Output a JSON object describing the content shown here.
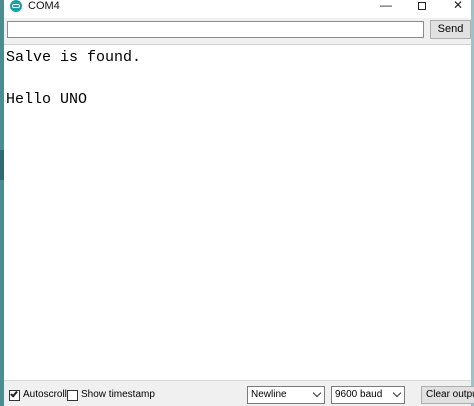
{
  "window": {
    "title": "COM4",
    "icon": "arduino-icon",
    "controls": {
      "minimize": "—",
      "close": "✕"
    }
  },
  "input_bar": {
    "value": "",
    "placeholder": "",
    "send_label": "Send"
  },
  "output": {
    "lines": [
      "Salve is found.",
      "Hello UNO"
    ]
  },
  "bottom_bar": {
    "autoscroll": {
      "label": "Autoscroll",
      "checked": true
    },
    "timestamp": {
      "label": "Show timestamp",
      "checked": false
    },
    "line_ending": {
      "selected": "Newline"
    },
    "baud_rate": {
      "selected": "9600 baud"
    },
    "clear_label": "Clear output"
  },
  "colors": {
    "accent": "#16a1a8",
    "toolbar_bg": "#f0f0f0"
  }
}
